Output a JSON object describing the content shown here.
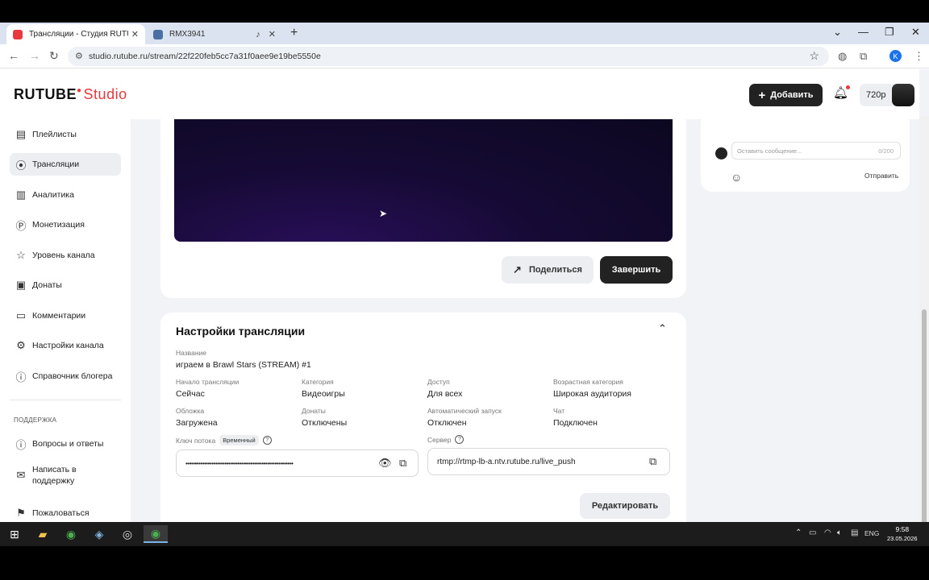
{
  "browser": {
    "tabs": [
      {
        "title": "Трансляции - Студия RUTUBE",
        "favicon_color": "#e8383d"
      },
      {
        "title": "RMX3941",
        "favicon_color": "#4a6fa5"
      }
    ],
    "url": "studio.rutube.ru/stream/22f220feb5cc7a31f0aee9e19be5550e",
    "profile_initial": "K"
  },
  "header": {
    "logo_main": "RUTUBE",
    "logo_studio": "Studio",
    "add_label": "Добавить",
    "quality_label": "720p"
  },
  "sidebar": {
    "items": [
      {
        "label": "Плейлисты",
        "icon": "playlist-icon"
      },
      {
        "label": "Трансляции",
        "icon": "broadcast-icon"
      },
      {
        "label": "Аналитика",
        "icon": "analytics-icon"
      },
      {
        "label": "Монетизация",
        "icon": "monetization-icon"
      },
      {
        "label": "Уровень канала",
        "icon": "star-icon"
      },
      {
        "label": "Донаты",
        "icon": "donate-icon"
      },
      {
        "label": "Комментарии",
        "icon": "comments-icon"
      },
      {
        "label": "Настройки канала",
        "icon": "settings-icon"
      },
      {
        "label": "Справочник блогера",
        "icon": "info-icon"
      }
    ],
    "support_section": "ПОДДЕРЖКА",
    "support_items": [
      {
        "label": "Вопросы и ответы",
        "icon": "help-icon"
      },
      {
        "label": "Написать в поддержку",
        "icon": "mail-icon"
      },
      {
        "label": "Пожаловаться",
        "icon": "flag-icon"
      }
    ]
  },
  "player": {
    "share_label": "Поделиться",
    "end_label": "Завершить"
  },
  "settings": {
    "title": "Настройки трансляции",
    "name_label": "Название",
    "name_value": "играем в Brawl Stars (STREAM) #1",
    "fields": [
      {
        "label": "Начало трансляции",
        "value": "Сейчас"
      },
      {
        "label": "Категория",
        "value": "Видеоигры"
      },
      {
        "label": "Доступ",
        "value": "Для всех"
      },
      {
        "label": "Возрастная категория",
        "value": "Широкая аудитория"
      },
      {
        "label": "Обложка",
        "value": "Загружена"
      },
      {
        "label": "Донаты",
        "value": "Отключены"
      },
      {
        "label": "Автоматический запуск",
        "value": "Отключен"
      },
      {
        "label": "Чат",
        "value": "Подключен"
      }
    ],
    "key_label": "Ключ потока",
    "key_tag": "Временный",
    "key_value": "••••••••••••••••••••••••••••••••••••••••••••••••••••••••••",
    "server_label": "Сервер",
    "server_value": "rtmp://rtmp-lb-a.ntv.rutube.ru/live_push",
    "edit_label": "Редактировать"
  },
  "chat": {
    "placeholder": "Оставить сообщение...",
    "counter": "0/200",
    "send_label": "Отправить"
  },
  "taskbar": {
    "lang": "ENG",
    "time": "9:58",
    "date": "23.05.2026"
  }
}
